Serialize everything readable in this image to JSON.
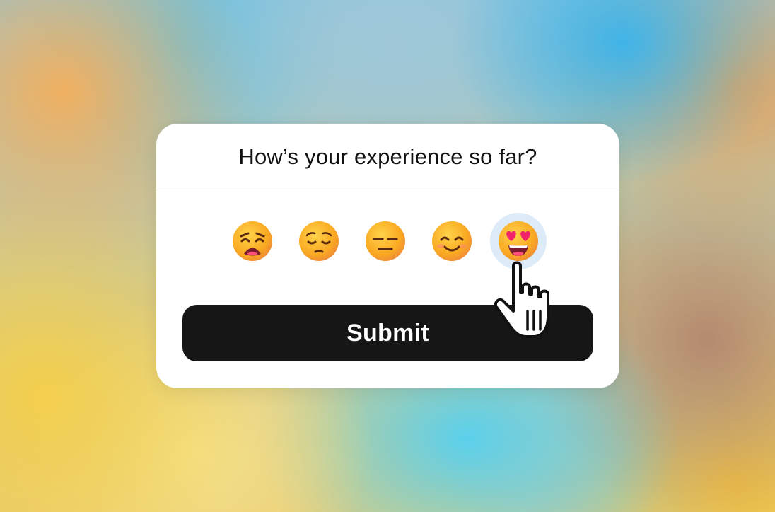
{
  "survey": {
    "question": "How’s your experience so far?",
    "submit_label": "Submit",
    "ratings": [
      {
        "name": "weary-face-icon",
        "selected": false
      },
      {
        "name": "pensive-face-icon",
        "selected": false
      },
      {
        "name": "expressionless-face-icon",
        "selected": false
      },
      {
        "name": "smiling-face-icon",
        "selected": false
      },
      {
        "name": "heart-eyes-face-icon",
        "selected": true
      }
    ]
  },
  "colors": {
    "button_bg": "#161616",
    "selected_highlight": "#dcebf7",
    "emoji_face": "#f9b81c"
  }
}
